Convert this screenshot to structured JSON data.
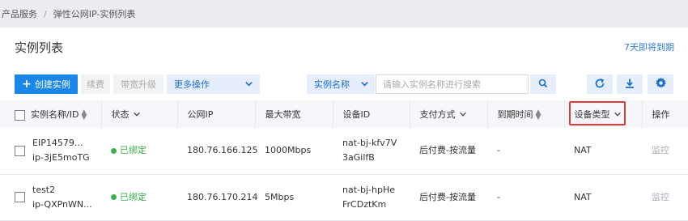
{
  "breadcrumb": {
    "root": "产品服务",
    "separator": "/",
    "current": "弹性公网IP-实例列表"
  },
  "page": {
    "title": "实例列表",
    "expiring_link": "7天即将到期"
  },
  "toolbar": {
    "create_label": "创建实例",
    "renew_label": "续费",
    "upgrade_label": "带宽升级",
    "more_label": "更多操作",
    "search_type_label": "实例名称",
    "search_placeholder": "请输入实例名称进行搜索"
  },
  "table": {
    "headers": {
      "name": "实例名称/ID",
      "status": "状态",
      "ip": "公网IP",
      "bandwidth": "最大带宽",
      "device_id": "设备ID",
      "payment": "支付方式",
      "expire": "到期时间",
      "device_type": "设备类型",
      "actions": "操作"
    },
    "rows": [
      {
        "name": "EIP14579...",
        "id": "ip-3jE5moTG",
        "status": "已绑定",
        "ip": "180.76.166.125",
        "bandwidth": "1000Mbps",
        "device_id_line1": "nat-bj-kfv7V",
        "device_id_line2": "3aGilfB",
        "payment": "后付费-按流量",
        "expire": "-",
        "device_type": "NAT",
        "action": "监控"
      },
      {
        "name": "test2",
        "id": "ip-QXPnWN...",
        "status": "已绑定",
        "ip": "180.76.170.214",
        "bandwidth": "5Mbps",
        "device_id_line1": "nat-bj-hpHe",
        "device_id_line2": "FrCDztKm",
        "payment": "后付费-按流量",
        "expire": "-",
        "device_type": "NAT",
        "action": "监控"
      }
    ]
  },
  "colors": {
    "accent": "#1a86e8",
    "status_green": "#3aaf4b",
    "highlight": "#e23a3a",
    "link": "#2e7dd8"
  },
  "icons": [
    "plus-icon",
    "chevron-down-icon",
    "search-icon",
    "refresh-icon",
    "download-icon",
    "gear-icon",
    "sort-icon"
  ]
}
